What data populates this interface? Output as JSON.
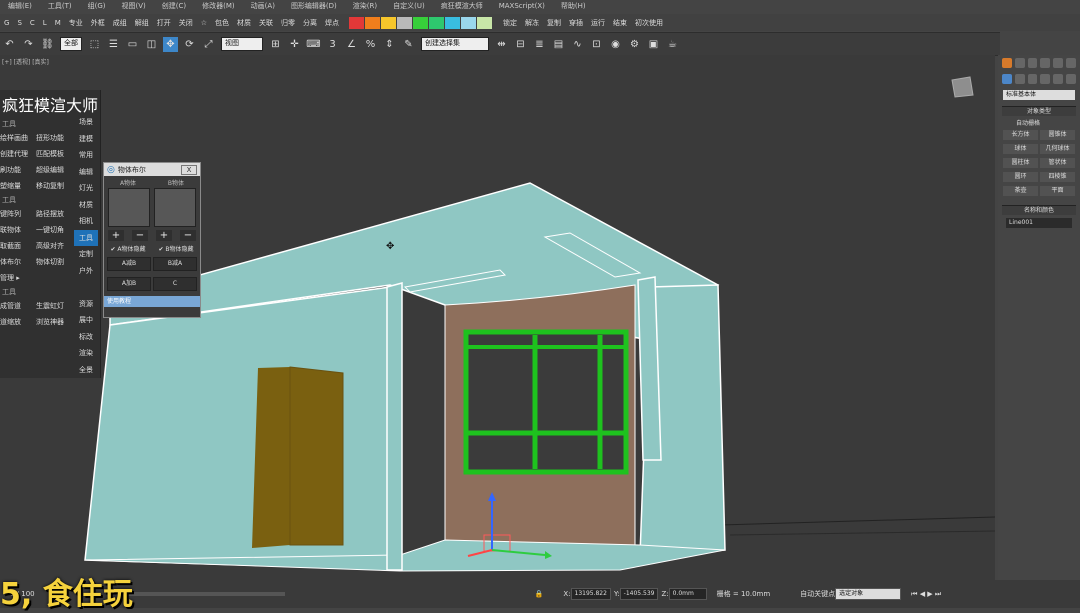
{
  "menu": [
    "编辑(E)",
    "工具(T)",
    "组(G)",
    "视图(V)",
    "创建(C)",
    "修改器(M)",
    "动画(A)",
    "图形编辑器(D)",
    "渲染(R)",
    "自定义(U)",
    "疯狂模渲大师",
    "MAXScript(X)",
    "帮助(H)"
  ],
  "row2": {
    "keys": [
      "G",
      "S",
      "C",
      "L",
      "M"
    ],
    "left_items": [
      "专业",
      "外框",
      "成组",
      "解组",
      "打开",
      "关闭",
      "☆",
      "包色",
      "材质",
      "关联",
      "归零",
      "分离",
      "焊点"
    ],
    "swatch_colors": [
      "#e23838",
      "#f07e1c",
      "#f6c62b",
      "#b9b9b9",
      "#37cf3a",
      "#2ec86e",
      "#39bde0",
      "#9ad7ec",
      "#c8e6a8"
    ],
    "right_items": [
      "锁定",
      "解冻",
      "复制",
      "穿插",
      "运行",
      "结束",
      "初次使用"
    ]
  },
  "toolbar": {
    "select_filter": "全部",
    "ref_coord": "视图",
    "selection_set": "创建选择集"
  },
  "viewport": {
    "label": "[+] [透视] [真实]",
    "colors": {
      "room": "#8fc7c3",
      "wall_back": "#8e6f5c",
      "door": "#7a6010",
      "window_frame": "#1ec21e",
      "glass": "#3b3b3b"
    }
  },
  "plugin": {
    "title": "疯狂模渲大师",
    "section1": "工具",
    "items1": [
      "绘样画曲",
      "扭形功能",
      "创建代理",
      "匹配模板",
      "刷功能",
      "超级编辑",
      "塑缩量",
      "移动复制"
    ],
    "section2": "工具",
    "items2": [
      "键阵列",
      "路径摆放",
      "联物体",
      "一键切角",
      "取截面",
      "高级对齐",
      "体布尔",
      "物体切割"
    ],
    "manager": "管理 ▸",
    "section3": "工具",
    "items3": [
      "成管道",
      "生震虹灯",
      "道缩放",
      "浏览神器"
    ],
    "tabs": [
      "场景",
      "建模",
      "常用",
      "编辑",
      "灯光",
      "材质",
      "相机",
      "工具",
      "定制",
      "户外",
      "",
      "资源",
      "展中",
      "标改",
      "渲染",
      "全景"
    ],
    "active_tab": "工具"
  },
  "dialog": {
    "title": "物体布尔",
    "label_a": "A物体",
    "label_b": "B物体",
    "plus": "+",
    "minus": "−",
    "hide_a": "A物体隐藏",
    "hide_b": "B物体隐藏",
    "btn_a_minus_b": "A减B",
    "btn_b_minus_a": "B减A",
    "btn_a_plus_b": "A加B",
    "btn_c": "C",
    "footer": "使用教程",
    "close": "X"
  },
  "command_panel": {
    "category": "标准基本体",
    "object_type_title": "对象类型",
    "auto_grid": "自动栅格",
    "objects": [
      "长方体",
      "圆锥体",
      "球体",
      "几何球体",
      "圆柱体",
      "管状体",
      "圆环",
      "四棱锥",
      "茶壶",
      "平面"
    ],
    "name_color_title": "名称和颜色",
    "name_value": "Line001"
  },
  "status": {
    "caption": "5, 食住玩",
    "frame": "0 / 100",
    "x_label": "X:",
    "x_value": "13195.822",
    "y_label": "Y:",
    "y_value": "-1405.539",
    "z_label": "Z:",
    "z_value": "0.0mm",
    "grid": "栅格 = 10.0mm",
    "auto_key": "自动关键点",
    "key_select": "选定对象"
  }
}
